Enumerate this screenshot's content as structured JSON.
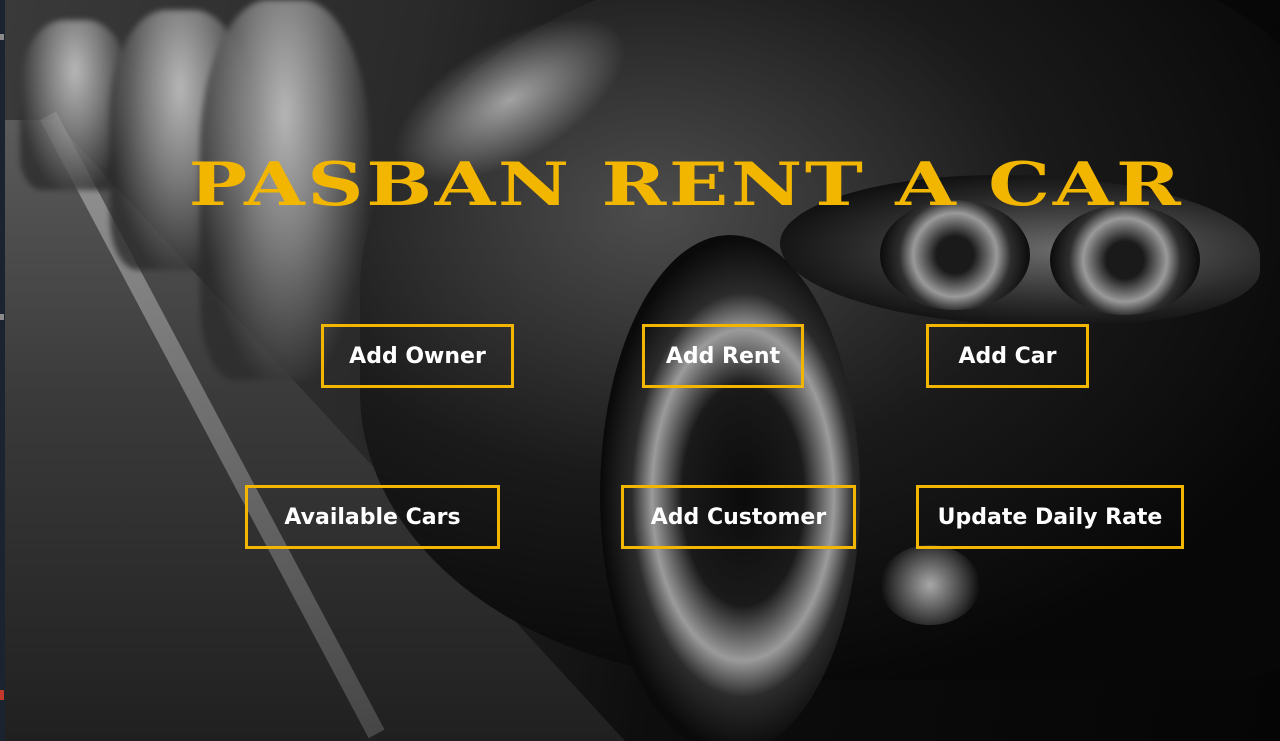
{
  "app": {
    "title": "PASBAN RENT A CAR"
  },
  "buttons": {
    "add_owner": "Add Owner",
    "add_rent": "Add Rent",
    "add_car": "Add Car",
    "available_cars": "Available Cars",
    "add_customer": "Add Customer",
    "update_daily_rate": "Update Daily Rate"
  },
  "colors": {
    "accent": "#f2b600",
    "button_text": "#ffffff",
    "background": "#000000"
  }
}
